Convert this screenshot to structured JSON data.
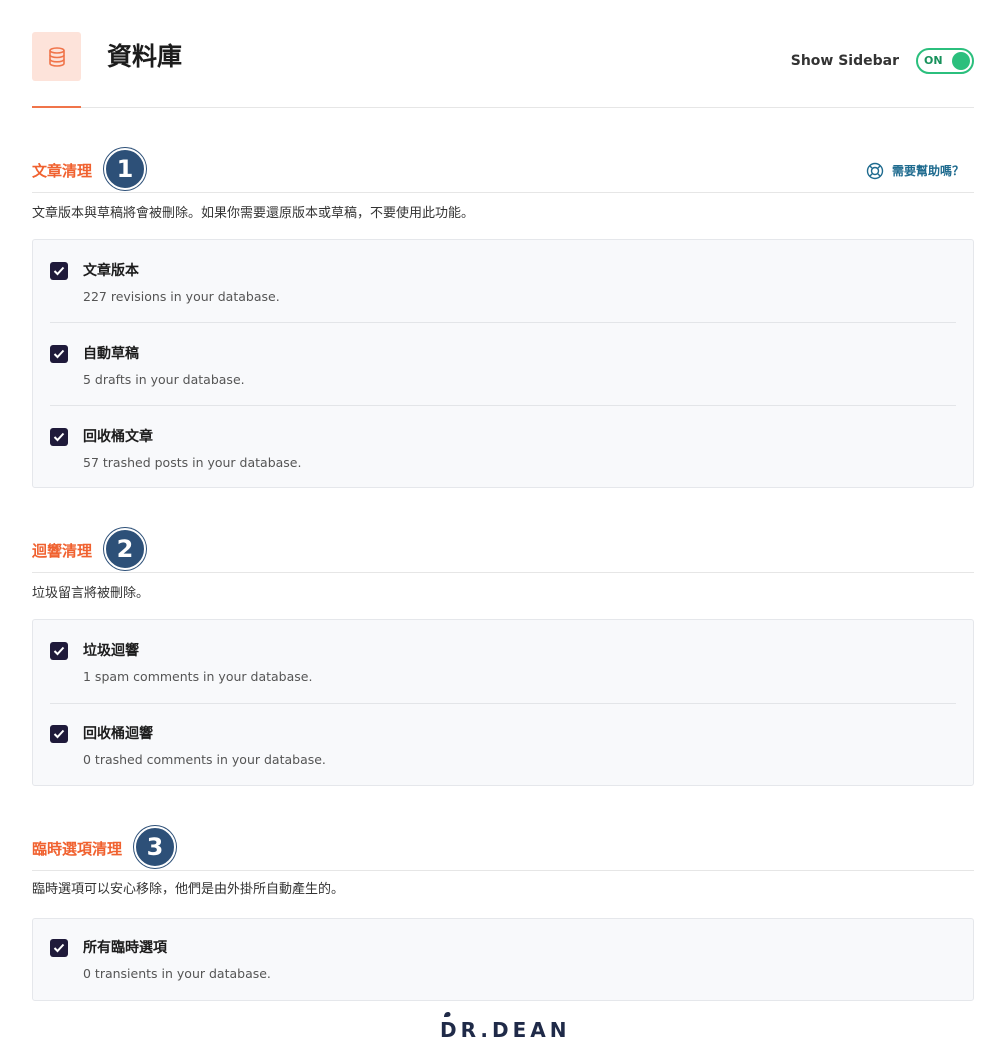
{
  "header": {
    "title": "資料庫",
    "icon": "database-icon",
    "sidebar_label": "Show Sidebar",
    "toggle_label": "ON",
    "toggle_on": true,
    "accent_color": "#f0744a",
    "toggle_color": "#2bbf7d"
  },
  "sections": [
    {
      "title": "文章清理",
      "badge": "1",
      "help": "需要幫助嗎？",
      "description": "文章版本與草稿將會被刪除。如果你需要還原版本或草稿，不要使用此功能。",
      "options": [
        {
          "label": "文章版本",
          "sub": "227 revisions in your database.",
          "checked": true
        },
        {
          "label": "自動草稿",
          "sub": "5 drafts in your database.",
          "checked": true
        },
        {
          "label": "回收桶文章",
          "sub": "57 trashed posts in your database.",
          "checked": true
        }
      ]
    },
    {
      "title": "迴響清理",
      "badge": "2",
      "description": "垃圾留言將被刪除。",
      "options": [
        {
          "label": "垃圾迴響",
          "sub": "1 spam comments in your database.",
          "checked": true
        },
        {
          "label": "回收桶迴響",
          "sub": "0 trashed comments in your database.",
          "checked": true
        }
      ]
    },
    {
      "title": "臨時選項清理",
      "badge": "3",
      "description": "臨時選項可以安心移除，他們是由外掛所自動產生的。",
      "options": [
        {
          "label": "所有臨時選項",
          "sub": "0 transients in your database.",
          "checked": true
        }
      ]
    }
  ],
  "footer": {
    "logo_text": "DR.DEAN"
  }
}
